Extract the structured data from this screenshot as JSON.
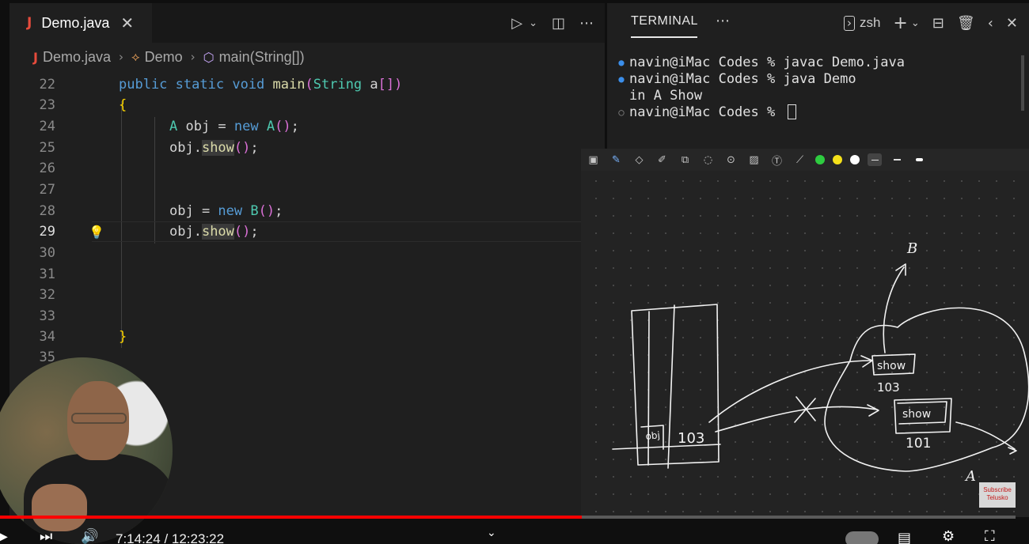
{
  "editor": {
    "tab": {
      "filename": "Demo.java",
      "file_icon": "J",
      "close_icon": "✕"
    },
    "toolbar_icons": [
      "run-icon",
      "chevron-down-icon",
      "split-editor-icon",
      "more-icon"
    ],
    "breadcrumb": [
      "Demo.java",
      "Demo",
      "main(String[])"
    ],
    "line_numbers": [
      "22",
      "23",
      "24",
      "25",
      "26",
      "27",
      "28",
      "29",
      "30",
      "31",
      "32",
      "33",
      "34",
      "35"
    ],
    "active_line": "29",
    "code": {
      "l22": {
        "kw1": "public",
        "kw2": "static",
        "kw3": "void",
        "fn": "main",
        "p1": "(",
        "ty": "String",
        "rest": " a",
        "p2": "[]",
        "p3": ")"
      },
      "l23": {
        "brace": "{"
      },
      "l24": {
        "ty": "A",
        "mid": " obj = ",
        "kw": "new",
        "sp": " ",
        "ty2": "A",
        "p": "()",
        "end": ";"
      },
      "l25": {
        "a": "obj.",
        "fn": "show",
        "p": "()",
        "end": ";"
      },
      "l28": {
        "a": "obj = ",
        "kw": "new",
        "sp": " ",
        "ty": "B",
        "p": "()",
        "end": ";"
      },
      "l29": {
        "a": "obj.",
        "fn": "show",
        "p": "()",
        "end": ";"
      },
      "l34": {
        "brace": "}"
      }
    }
  },
  "terminal": {
    "tab_label": "TERMINAL",
    "shell": "zsh",
    "lines": [
      {
        "prompt": "navin@iMac Codes % ",
        "cmd": "javac Demo.java"
      },
      {
        "prompt": "navin@iMac Codes % ",
        "cmd": "java Demo"
      },
      {
        "output": "in A Show"
      },
      {
        "prompt": "navin@iMac Codes % ",
        "cmd": ""
      }
    ]
  },
  "drawing": {
    "tool_icons": [
      "image-icon",
      "pen-icon",
      "eraser-icon",
      "highlighter-icon",
      "shapes-icon",
      "lasso-icon",
      "laser-icon",
      "insert-image-icon",
      "text-icon",
      "ruler-icon"
    ],
    "colors": [
      "#2ecc40",
      "#f5e11a",
      "#ffffff"
    ],
    "sketch_text": {
      "obj": "obj",
      "ref": "103",
      "b_label": "B",
      "a_label": "A",
      "show1": "show",
      "addr1": "103",
      "show2": "show",
      "addr2": "101"
    },
    "subscribe": {
      "line1": "Subscribe",
      "line2": "Telusko"
    }
  },
  "video": {
    "time": "7:14:24 / 12:23:22",
    "progress": 0.573,
    "accent": "#ff0000"
  }
}
